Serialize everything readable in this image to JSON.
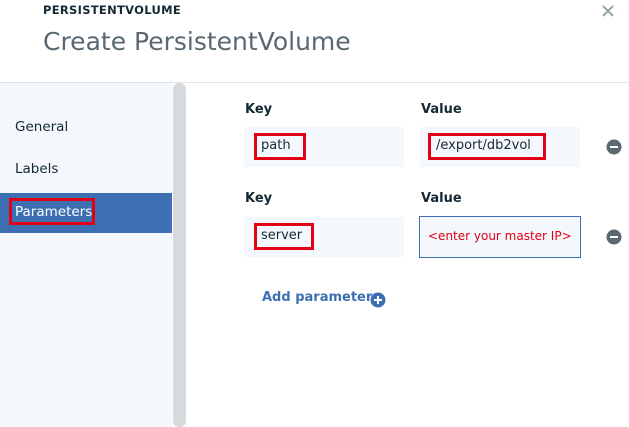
{
  "header": {
    "eyebrow": "PERSISTENTVOLUME",
    "title": "Create PersistentVolume",
    "close_icon": "close-icon"
  },
  "sidebar": {
    "items": [
      {
        "label": "General",
        "active": false
      },
      {
        "label": "Labels",
        "active": false
      },
      {
        "label": "Parameters",
        "active": true
      }
    ]
  },
  "parameters": {
    "rows": [
      {
        "key_label": "Key",
        "value_label": "Value",
        "key": "path",
        "value": "/export/db2vol",
        "value_placeholder": ""
      },
      {
        "key_label": "Key",
        "value_label": "Value",
        "key": "server",
        "value": "",
        "value_placeholder": "<enter your master IP>"
      }
    ],
    "add_label": "Add parameter"
  },
  "colors": {
    "accent": "#3d70b2",
    "highlight": "#e10014",
    "field_bg": "#f4f7fb"
  }
}
